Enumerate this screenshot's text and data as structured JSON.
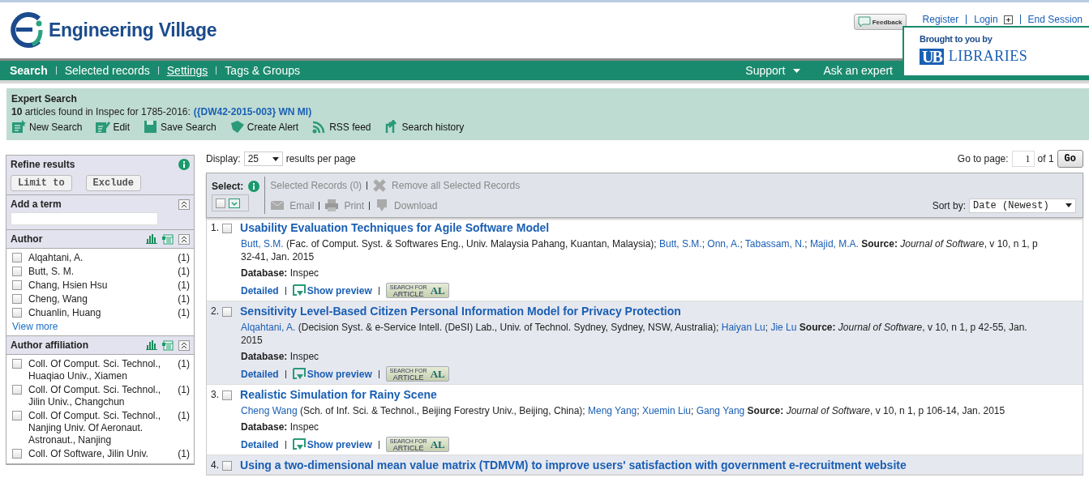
{
  "header": {
    "logo_text": "Engineering Village",
    "feedback": "Feedback",
    "links": [
      "Register",
      "Login",
      "End Session"
    ],
    "brought_by": "Brought to you by",
    "library_mark": "UB",
    "library_name": "LIBRARIES"
  },
  "nav": {
    "items": [
      {
        "label": "Search",
        "selected": true,
        "hovered": false
      },
      {
        "label": "Selected records",
        "selected": false,
        "hovered": false
      },
      {
        "label": "Settings",
        "selected": false,
        "hovered": true
      },
      {
        "label": "Tags & Groups",
        "selected": false,
        "hovered": false
      }
    ],
    "right": [
      {
        "label": "Support",
        "kind": "dropdown"
      },
      {
        "label": "Ask an expert",
        "kind": "link"
      }
    ]
  },
  "summary": {
    "title": "Expert Search",
    "text": "**10** articles found in Inspec for 1785-2016:",
    "query": "({DW42-2015-003} WN MI)",
    "actions": [
      {
        "label": "New Search",
        "kind": "new"
      },
      {
        "label": "Edit",
        "kind": "edit"
      },
      {
        "label": "Save Search",
        "kind": "save"
      },
      {
        "label": "Create Alert",
        "kind": "alert"
      },
      {
        "label": "RSS feed",
        "kind": "rss"
      },
      {
        "label": "Search history",
        "kind": "history"
      }
    ]
  },
  "sidebar": {
    "title": "Refine results",
    "buttons": [
      "Limit to",
      "Exclude"
    ],
    "add_term": {
      "title": "Add a term"
    },
    "facets": [
      {
        "title": "Author",
        "view_more": "View more",
        "items": [
          {
            "label": "Alqahtani, A.",
            "count": "(1)",
            "checked": false
          },
          {
            "label": "Butt, S. M.",
            "count": "(1)",
            "checked": false
          },
          {
            "label": "Chang, Hsien Hsu",
            "count": "(1)",
            "checked": false
          },
          {
            "label": "Cheng, Wang",
            "count": "(1)",
            "checked": false
          },
          {
            "label": "Chuanlin, Huang",
            "count": "(1)",
            "checked": false
          }
        ]
      },
      {
        "title": "Author affiliation",
        "items": [
          {
            "label": "Coll. Of Comput. Sci. Technol., Huaqiao Univ., Xiamen",
            "count": "(1)",
            "checked": false
          },
          {
            "label": "Coll. Of Comput. Sci. Technol., Jilin Univ., Changchun",
            "count": "(1)",
            "checked": false
          },
          {
            "label": "Coll. Of Comput. Sci. Technol., Nanjing Univ. Of Aeronaut. Astronaut., Nanjing",
            "count": "(1)",
            "checked": false
          },
          {
            "label": "Coll. Of Software, Jilin Univ.",
            "count": "(1)",
            "checked": false
          }
        ]
      }
    ]
  },
  "display": {
    "label": "Display:",
    "value": "25",
    "suffix": "results per page"
  },
  "goto": {
    "label": "Go to page:",
    "value": "1",
    "of": "of 1",
    "button": "Go"
  },
  "toolbar": {
    "select_label": "Select:",
    "select_checked": false,
    "selected_records": "Selected Records (0)",
    "remove": "Remove all Selected Records",
    "actions": [
      {
        "label": "Email",
        "kind": "email",
        "disabled": true
      },
      {
        "label": "Print",
        "kind": "print",
        "disabled": true
      },
      {
        "label": "Download",
        "kind": "download",
        "disabled": true
      }
    ],
    "sort_label": "Sort by:",
    "sort_value": "Date (Newest)"
  },
  "results": [
    {
      "number": "1.",
      "checked": false,
      "title": "Usability Evaluation Techniques for Agile Software Model",
      "byline": [
        {
          "text": "Butt, S.M.",
          "kind": "link"
        },
        {
          "text": " (Fac. of Comput. Syst. & Softwares Eng., Univ. Malaysia Pahang, Kuantan, Malaysia); ",
          "kind": "plain"
        },
        {
          "text": "Butt, S.M.",
          "kind": "link"
        },
        {
          "text": "; ",
          "kind": "plain"
        },
        {
          "text": "Onn, A.",
          "kind": "link"
        },
        {
          "text": "; ",
          "kind": "plain"
        },
        {
          "text": "Tabassam, N.",
          "kind": "link"
        },
        {
          "text": "; ",
          "kind": "plain"
        },
        {
          "text": "Majid, M.A.",
          "kind": "link"
        }
      ],
      "source_label": "Source:",
      "journal": "Journal of Software",
      "source_rest": ", v 10, n 1, p 32-41, Jan. 2015",
      "database_label": "Database:",
      "database": "Inspec",
      "detailed": "Detailed",
      "preview": "Show preview",
      "badge_top": "SEARCH FOR",
      "badge_bottom": "ARTICLE",
      "badge_mark": "AL"
    },
    {
      "number": "2.",
      "checked": false,
      "title": "Sensitivity Level-Based Citizen Personal Information Model for Privacy Protection",
      "byline": [
        {
          "text": "Alqahtani, A.",
          "kind": "link"
        },
        {
          "text": " (Decision Syst. & e-Service Intell. (DeSI) Lab., Univ. of Technol. Sydney, Sydney, NSW, Australia); ",
          "kind": "plain"
        },
        {
          "text": "Haiyan Lu",
          "kind": "link"
        },
        {
          "text": "; ",
          "kind": "plain"
        },
        {
          "text": "Jie Lu",
          "kind": "link"
        }
      ],
      "source_label": "Source:",
      "journal": "Journal of Software",
      "source_rest": ", v 10, n 1, p 42-55, Jan. 2015",
      "database_label": "Database:",
      "database": "Inspec",
      "detailed": "Detailed",
      "preview": "Show preview",
      "badge_top": "SEARCH FOR",
      "badge_bottom": "ARTICLE",
      "badge_mark": "AL"
    },
    {
      "number": "3.",
      "checked": false,
      "title": "Realistic Simulation for Rainy Scene",
      "byline": [
        {
          "text": "Cheng Wang",
          "kind": "link"
        },
        {
          "text": " (Sch. of Inf. Sci. & Technol., Beijing Forestry Univ., Beijing, China); ",
          "kind": "plain"
        },
        {
          "text": "Meng Yang",
          "kind": "link"
        },
        {
          "text": "; ",
          "kind": "plain"
        },
        {
          "text": "Xuemin Liu",
          "kind": "link"
        },
        {
          "text": "; ",
          "kind": "plain"
        },
        {
          "text": "Gang Yang",
          "kind": "link"
        }
      ],
      "source_label": "Source:",
      "journal": "Journal of Software",
      "source_rest": ", v 10, n 1, p 106-14, Jan. 2015",
      "database_label": "Database:",
      "database": "Inspec",
      "detailed": "Detailed",
      "preview": "Show preview",
      "badge_top": "SEARCH FOR",
      "badge_bottom": "ARTICLE",
      "badge_mark": "AL"
    },
    {
      "number": "4.",
      "checked": false,
      "title": "Using a two-dimensional mean value matrix (TDMVM) to improve users' satisfaction with government e-recruitment website"
    }
  ]
}
